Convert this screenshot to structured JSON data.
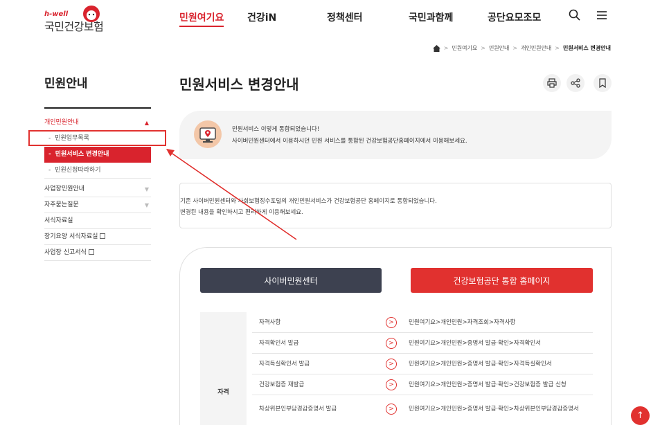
{
  "header": {
    "logo_small": "h-well",
    "logo_main": "국민건강보험",
    "nav": [
      "민원여기요",
      "건강iN",
      "정책센터",
      "국민과함께",
      "공단요모조모"
    ],
    "active_nav": "민원여기요",
    "search_icon": "search-icon",
    "menu_icon": "hamburger-menu-icon"
  },
  "breadcrumb": {
    "home_icon": "home-icon",
    "items": [
      "민원여기요",
      "민원안내",
      "개인민원안내",
      "민원서비스 변경안내"
    ]
  },
  "sidebar": {
    "title": "민원안내",
    "items": [
      {
        "label": "개인민원안내",
        "expanded": true
      },
      {
        "label": "민원업무목록"
      },
      {
        "label": "민원서비스 변경안내",
        "active": true
      },
      {
        "label": "민원신청따라하기"
      },
      {
        "label": "사업장민원안내"
      },
      {
        "label": "자주묻는질문"
      },
      {
        "label": "서식자료실"
      },
      {
        "label": "장기요양 서식자료실"
      },
      {
        "label": "사업장 신고서식"
      }
    ]
  },
  "main": {
    "title": "민원서비스 변경안내",
    "tools": [
      "print-icon",
      "share-icon",
      "bookmark-icon"
    ],
    "notice": {
      "line1": "민원서비스 이렇게 통합되었습니다!",
      "line2": "사이버민원센터에서 이용하시던 민원 서비스를 통합된 건강보험공단홈페이지에서 이용해보세요."
    },
    "description": {
      "line1": "기존 사이버민원센터와 사회보험징수포털의 개인민원서비스가 건강보험공단 홈페이지로 통합되었습니다.",
      "line2": "변경된 내용을 확인하시고 편리하게 이용해보세요."
    },
    "compare": {
      "left_button": "사이버민원센터",
      "right_button": "건강보험공단 통합 홈페이지",
      "category": "자격",
      "rows": [
        {
          "old": "자격사항",
          "new": "민원여기요>개인민원>자격조회>자격사항"
        },
        {
          "old": "자격확인서 발급",
          "new": "민원여기요>개인민원>증명서 발급·확인>자격확인서"
        },
        {
          "old": "자격득실확인서 발급",
          "new": "민원여기요>개인민원>증명서 발급·확인>자격득실확인서"
        },
        {
          "old": "건강보험증 재발급",
          "new": "민원여기요>개인민원>증명서 발급·확인>건강보험증 발급 신청"
        },
        {
          "old": "차상위본인부담경감증명서 발급",
          "new": "민원여기요>개인민원>증명서 발급·확인>차상위본인부담경감증명서"
        }
      ]
    }
  },
  "top_button": "↑",
  "colors": {
    "accent": "#d9232d",
    "dark_button": "#3d4150",
    "red_button": "#e1312f"
  }
}
